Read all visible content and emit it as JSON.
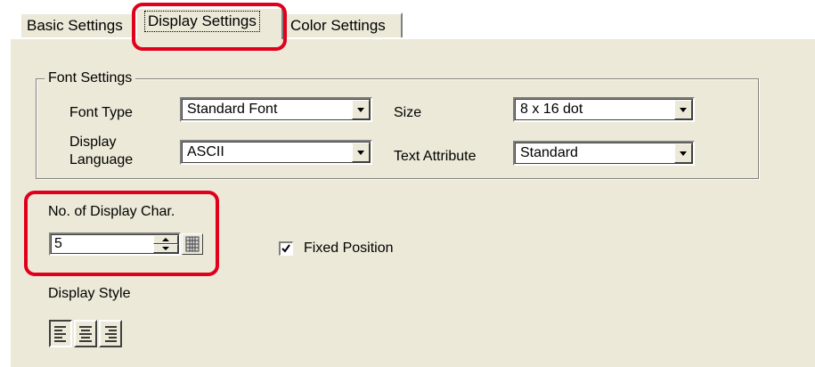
{
  "tabs": [
    {
      "label": "Basic Settings",
      "active": false
    },
    {
      "label": "Display Settings",
      "active": true
    },
    {
      "label": "Color Settings",
      "active": false
    }
  ],
  "font_settings": {
    "title": "Font Settings",
    "font_type_label": "Font Type",
    "font_type_value": "Standard Font",
    "display_language_label_line1": "Display",
    "display_language_label_line2": "Language",
    "display_language_value": "ASCII",
    "size_label": "Size",
    "size_value": "8 x 16 dot",
    "text_attribute_label": "Text Attribute",
    "text_attribute_value": "Standard"
  },
  "display_char": {
    "label": "No. of Display Char.",
    "value": "5"
  },
  "fixed_position": {
    "label": "Fixed Position",
    "checked": true
  },
  "display_style": {
    "label": "Display Style",
    "buttons": [
      {
        "icon": "align-left-icon",
        "pressed": true
      },
      {
        "icon": "align-center-icon",
        "pressed": false
      },
      {
        "icon": "align-right-icon",
        "pressed": false
      }
    ]
  },
  "colors": {
    "panel_bg": "#ece9d8",
    "highlight": "#e0001b"
  }
}
